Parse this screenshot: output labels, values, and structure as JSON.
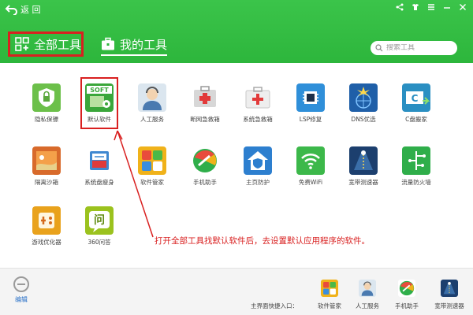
{
  "header": {
    "back_label": "返 回",
    "tabs": [
      {
        "label": "全部工具",
        "active": true
      },
      {
        "label": "我的工具",
        "active": false
      }
    ],
    "search_placeholder": "搜索工具"
  },
  "tools": [
    {
      "label": "隐私保镖",
      "icon": "shield-lock-icon",
      "color": "#5fb842"
    },
    {
      "label": "默认软件",
      "icon": "soft-gear-icon",
      "color": "#3aa63a"
    },
    {
      "label": "人工服务",
      "icon": "support-agent-icon",
      "color": "#7a9bb8"
    },
    {
      "label": "断网急救箱",
      "icon": "network-firstaid-icon",
      "color": "#c9c9c9"
    },
    {
      "label": "系统急救箱",
      "icon": "system-firstaid-icon",
      "color": "#e6e6e6"
    },
    {
      "label": "LSP修复",
      "icon": "lsp-chip-icon",
      "color": "#2f8fd9"
    },
    {
      "label": "DNS优选",
      "icon": "dns-globe-icon",
      "color": "#1f5fa8"
    },
    {
      "label": "C盘搬家",
      "icon": "c-drive-move-icon",
      "color": "#2a8fc2"
    },
    {
      "label": "隔离沙箱",
      "icon": "sandbox-icon",
      "color": "#d86a2b"
    },
    {
      "label": "系统盘瘦身",
      "icon": "disk-slim-icon",
      "color": "#3f88d0"
    },
    {
      "label": "软件管家",
      "icon": "software-manager-icon",
      "color": "#f0b21a"
    },
    {
      "label": "手机助手",
      "icon": "phone-assistant-icon",
      "color": "#2fae4a"
    },
    {
      "label": "主页防护",
      "icon": "homepage-shield-icon",
      "color": "#2d7fcf"
    },
    {
      "label": "免费WiFi",
      "icon": "wifi-icon",
      "color": "#3cb84a"
    },
    {
      "label": "宽带测速器",
      "icon": "speed-test-icon",
      "color": "#1c3f6e"
    },
    {
      "label": "流量防火墙",
      "icon": "traffic-firewall-icon",
      "color": "#2fae4a"
    },
    {
      "label": "游戏优化器",
      "icon": "game-optimizer-icon",
      "color": "#e9a21c"
    },
    {
      "label": "360问答",
      "icon": "qa-icon",
      "color": "#9bc21e"
    }
  ],
  "annotation": "打开全部工具找默认软件后，去设置默认应用程序的软件。",
  "footer": {
    "edit_label": "编辑",
    "quick_entry_label": "主界面快捷入口：",
    "quick_items": [
      {
        "label": "软件管家",
        "icon": "software-manager-icon"
      },
      {
        "label": "人工服务",
        "icon": "support-agent-icon"
      },
      {
        "label": "手机助手",
        "icon": "phone-assistant-icon"
      },
      {
        "label": "宽带测速器",
        "icon": "speed-test-icon"
      }
    ]
  },
  "colors": {
    "header_green": "#2db63c",
    "highlight_red": "#d92020",
    "link_blue": "#2b72c8"
  }
}
